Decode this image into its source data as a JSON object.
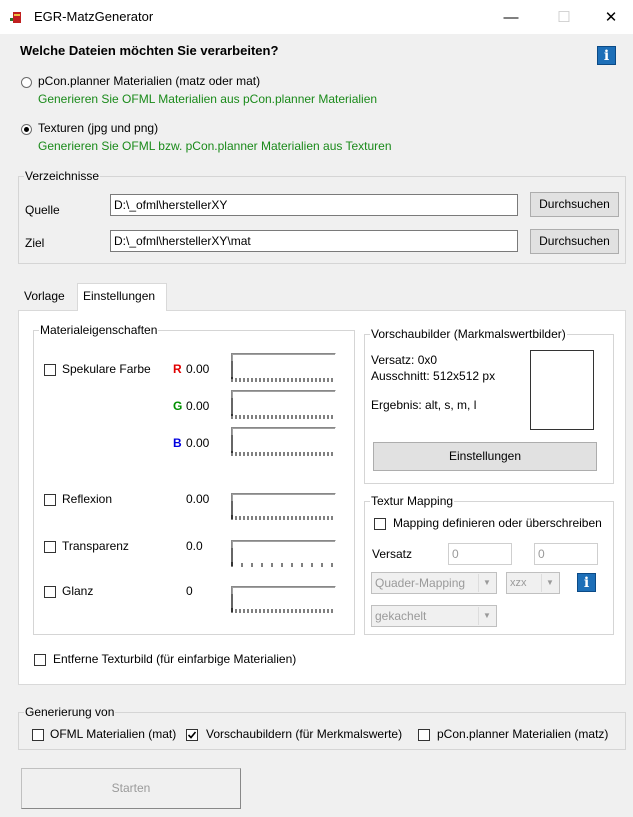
{
  "window": {
    "title": "EGR-MatzGenerator",
    "minimize": "—",
    "maximize": "☐",
    "close": "✕"
  },
  "question": "Welche Dateien möchten Sie verarbeiten?",
  "info_glyph": "i",
  "options": [
    {
      "label": "pCon.planner Materialien (matz oder mat)",
      "desc": "Generieren Sie OFML Materialien aus pCon.planner Materialien",
      "selected": false
    },
    {
      "label": "Texturen (jpg und png)",
      "desc": "Generieren Sie OFML bzw. pCon.planner Materialien aus Texturen",
      "selected": true
    }
  ],
  "verzeichnisse": {
    "legend": "Verzeichnisse",
    "quelle_label": "Quelle",
    "quelle_value": "D:\\_ofml\\herstellerXY",
    "ziel_label": "Ziel",
    "ziel_value": "D:\\_ofml\\herstellerXY\\mat",
    "browse_label": "Durchsuchen"
  },
  "tabs": [
    {
      "label": "Vorlage",
      "active": false
    },
    {
      "label": "Einstellungen",
      "active": true
    }
  ],
  "material": {
    "legend": "Materialeigenschaften",
    "specular_label": "Spekulare Farbe",
    "r_label": "R",
    "r_value": "0.00",
    "g_label": "G",
    "g_value": "0.00",
    "b_label": "B",
    "b_value": "0.00",
    "reflexion_label": "Reflexion",
    "reflexion_value": "0.00",
    "transparenz_label": "Transparenz",
    "transparenz_value": "0.0",
    "glanz_label": "Glanz",
    "glanz_value": "0",
    "colors": {
      "r": "#e00000",
      "g": "#009000",
      "b": "#0000e0"
    }
  },
  "preview": {
    "legend": "Vorschaubilder (Markmalswertbilder)",
    "versatz": "Versatz: 0x0",
    "ausschnitt": "Ausschnitt: 512x512 px",
    "ergebnis": "Ergebnis: alt, s, m, l",
    "button": "Einstellungen"
  },
  "mapping": {
    "legend": "Textur Mapping",
    "define_label": "Mapping definieren oder überschreiben",
    "versatz_label": "Versatz",
    "versatz_x": "0",
    "versatz_y": "0",
    "mapping_type": "Quader-Mapping",
    "axes": "xzx",
    "tiling": "gekachelt"
  },
  "remove_texture_label": "Entferne Texturbild (für einfarbige Materialien)",
  "generation": {
    "legend": "Generierung von",
    "items": [
      {
        "label": "OFML Materialien (mat)",
        "checked": false
      },
      {
        "label": "Vorschaubildern (für Merkmalswerte)",
        "checked": true
      },
      {
        "label": "pCon.planner Materialien (matz)",
        "checked": false
      }
    ]
  },
  "start_label": "Starten",
  "colors": {
    "info_blue": "#1d6fb8",
    "green_text": "#1a8a1a",
    "background": "#f0f0f0"
  }
}
